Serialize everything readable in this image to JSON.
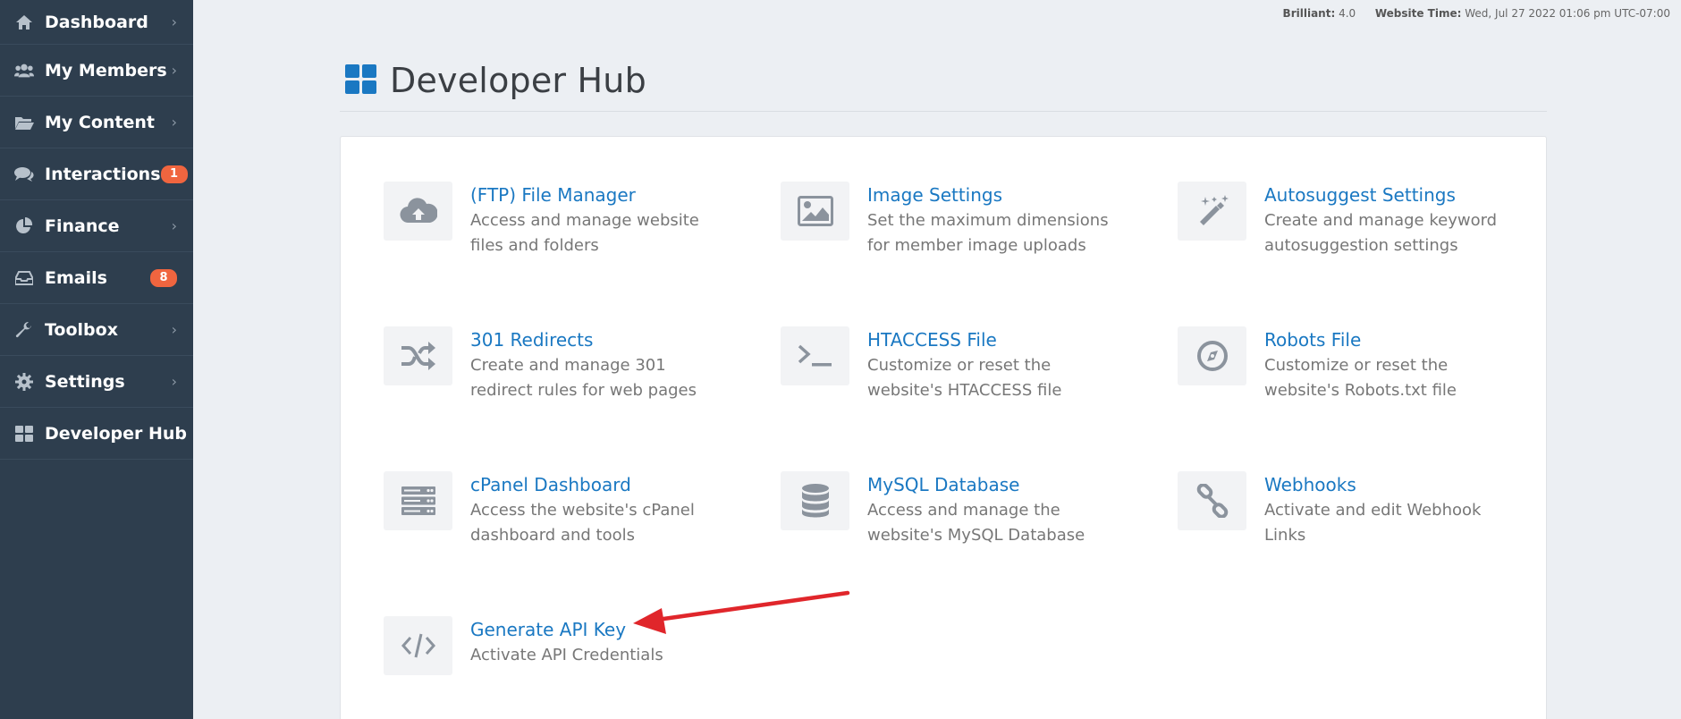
{
  "sidebar": {
    "items": [
      {
        "label": "Dashboard",
        "icon": "home-icon",
        "chevron": "›",
        "badge": ""
      },
      {
        "label": "My Members",
        "icon": "users-icon",
        "chevron": "›",
        "badge": ""
      },
      {
        "label": "My Content",
        "icon": "folder-icon",
        "chevron": "›",
        "badge": ""
      },
      {
        "label": "Interactions",
        "icon": "comments-icon",
        "chevron": "",
        "badge": "1"
      },
      {
        "label": "Finance",
        "icon": "pie-chart-icon",
        "chevron": "›",
        "badge": ""
      },
      {
        "label": "Emails",
        "icon": "inbox-icon",
        "chevron": "",
        "badge": "8"
      },
      {
        "label": "Toolbox",
        "icon": "wrench-icon",
        "chevron": "›",
        "badge": ""
      },
      {
        "label": "Settings",
        "icon": "gear-icon",
        "chevron": "›",
        "badge": ""
      },
      {
        "label": "Developer Hub",
        "icon": "grid-icon",
        "chevron": "",
        "badge": ""
      }
    ]
  },
  "topinfo": {
    "plan_label": "Brilliant:",
    "plan_value": "4.0",
    "time_label": "Website Time:",
    "time_value": "Wed, Jul 27 2022 01:06 pm UTC-07:00"
  },
  "header": {
    "title": "Developer Hub",
    "icon": "grid-icon"
  },
  "tiles": [
    {
      "title": "(FTP) File Manager",
      "desc1": "Access and manage website",
      "desc2": "files and folders",
      "icon": "cloud-upload-icon"
    },
    {
      "title": "Image Settings",
      "desc1": "Set the maximum dimensions",
      "desc2": "for member image uploads",
      "icon": "image-icon"
    },
    {
      "title": "Autosuggest Settings",
      "desc1": "Create and manage keyword",
      "desc2": "autosuggestion settings",
      "icon": "magic-wand-icon"
    },
    {
      "title": "301 Redirects",
      "desc1": "Create and manage 301",
      "desc2": "redirect rules for web pages",
      "icon": "shuffle-icon"
    },
    {
      "title": "HTACCESS File",
      "desc1": "Customize or reset the",
      "desc2": "website's HTACCESS file",
      "icon": "terminal-icon"
    },
    {
      "title": "Robots File",
      "desc1": "Customize or reset the",
      "desc2": "website's Robots.txt file",
      "icon": "compass-icon"
    },
    {
      "title": "cPanel Dashboard",
      "desc1": "Access the website's cPanel",
      "desc2": "dashboard and tools",
      "icon": "server-icon"
    },
    {
      "title": "MySQL Database",
      "desc1": "Access and manage the",
      "desc2": "website's MySQL Database",
      "icon": "database-icon"
    },
    {
      "title": "Webhooks",
      "desc1": "Activate and edit Webhook",
      "desc2": "Links",
      "icon": "link-icon"
    },
    {
      "title": "Generate API Key",
      "desc1": "Activate API Credentials",
      "desc2": "",
      "icon": "code-icon"
    }
  ],
  "colors": {
    "sidebar_bg": "#2e3e4e",
    "link": "#1a78c2",
    "badge": "#f0653f",
    "arrow": "#e0262b",
    "accent_icon": "#1a78c2"
  }
}
